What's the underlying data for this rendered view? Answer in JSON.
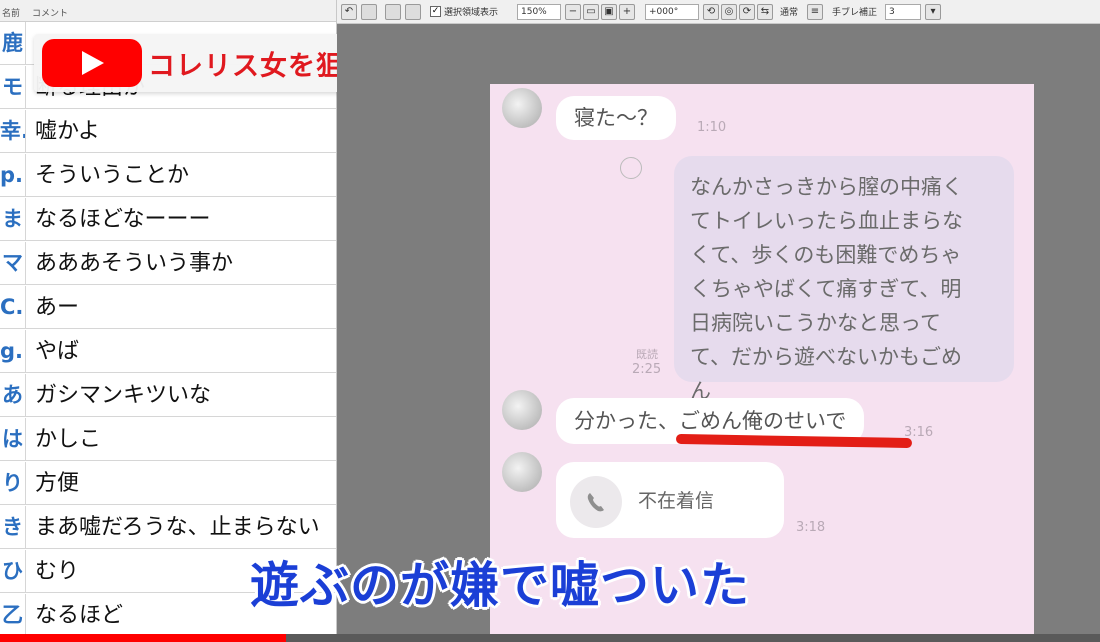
{
  "video": {
    "title": "コレリス女を狙う巨漢男",
    "subtitle": "遊ぶのが嫌で嘘ついた",
    "progress_fraction": 0.26
  },
  "comment_list": {
    "header_name": "名前",
    "header_comment": "コメント",
    "rows": [
      {
        "name": "鹿",
        "text": ""
      },
      {
        "name": "モ",
        "text": "断る理由か"
      },
      {
        "name": "幸.",
        "text": "嘘かよ"
      },
      {
        "name": "p.",
        "text": "そういうことか"
      },
      {
        "name": "ま",
        "text": "なるほどなーーー"
      },
      {
        "name": "マ",
        "text": "あああそういう事か"
      },
      {
        "name": "C.",
        "text": "あー"
      },
      {
        "name": "g.",
        "text": "やば"
      },
      {
        "name": "あ",
        "text": "ガシマンキツいな"
      },
      {
        "name": "は",
        "text": "かしこ"
      },
      {
        "name": "り",
        "text": "方便"
      },
      {
        "name": "き",
        "text": "まあ嘘だろうな、止まらない"
      },
      {
        "name": "ひ",
        "text": "むり"
      },
      {
        "name": "乙",
        "text": "なるほど"
      }
    ]
  },
  "toolbar": {
    "show_selection_label": "選択領域表示",
    "zoom_value": "150%",
    "angle_value": "+000°",
    "mode_label": "通常",
    "stabilizer_label": "手ブレ補正",
    "stabilizer_value": "3"
  },
  "chat": {
    "msg1_text": "寝た〜？",
    "msg1_time": "1:10",
    "msg2_lines": [
      "なんかさっきから膣の中痛く",
      "てトイレいったら血止まらな",
      "くて、歩くのも困難でめちゃ",
      "くちゃやばくて痛すぎて、明",
      "日病院いこうかなと思って",
      "て、だから遊べないかもごめ",
      "ん"
    ],
    "msg2_read": "既読",
    "msg2_time": "2:25",
    "msg3_text": "分かった、ごめん俺のせいで",
    "msg3_time": "3:16",
    "missed_call_label": "不在着信",
    "missed_call_time": "3:18"
  },
  "colors": {
    "youtube_red": "#ff0000",
    "title_red": "#e0191f",
    "subtitle_blue": "#1b3fd6",
    "chat_background": "#f6e1f0",
    "outgoing_bubble": "#e6dbed",
    "underline_red": "#e31e16"
  }
}
